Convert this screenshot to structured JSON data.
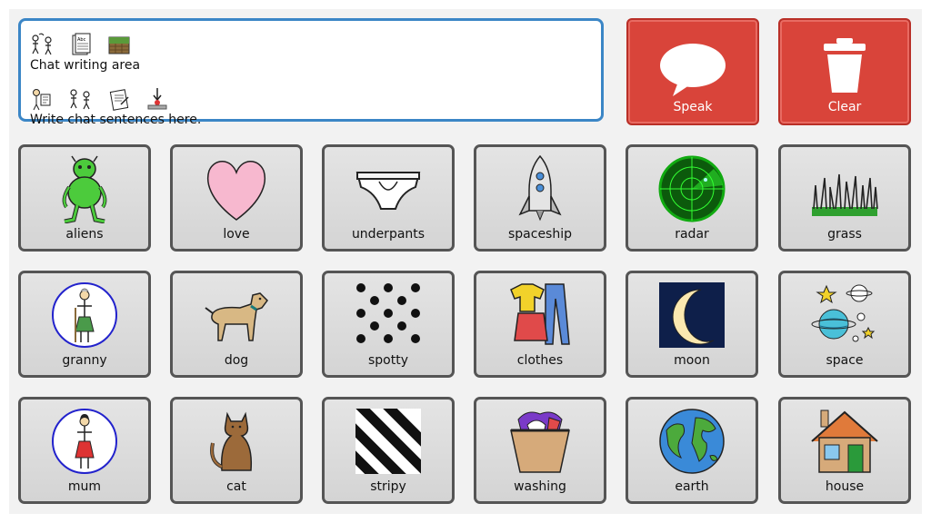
{
  "chat": {
    "line1_text": "Chat writing area",
    "line1_symbols": [
      "chat-symbol-icon",
      "writing-symbol-icon",
      "area-symbol-icon"
    ],
    "line2_text": "Write chat sentences here.",
    "line2_symbols": [
      "write-symbol-icon",
      "chat-symbol-icon",
      "sentences-symbol-icon",
      "here-symbol-icon"
    ]
  },
  "actions": {
    "speak_label": "Speak",
    "clear_label": "Clear"
  },
  "tiles": [
    {
      "label": "aliens",
      "icon": "alien-icon"
    },
    {
      "label": "love",
      "icon": "heart-icon"
    },
    {
      "label": "underpants",
      "icon": "underpants-icon"
    },
    {
      "label": "spaceship",
      "icon": "rocket-icon"
    },
    {
      "label": "radar",
      "icon": "radar-icon"
    },
    {
      "label": "grass",
      "icon": "grass-icon"
    },
    {
      "label": "granny",
      "icon": "granny-icon"
    },
    {
      "label": "dog",
      "icon": "dog-icon"
    },
    {
      "label": "spotty",
      "icon": "spots-icon"
    },
    {
      "label": "clothes",
      "icon": "clothes-icon"
    },
    {
      "label": "moon",
      "icon": "moon-icon"
    },
    {
      "label": "space",
      "icon": "planets-icon"
    },
    {
      "label": "mum",
      "icon": "mum-icon"
    },
    {
      "label": "cat",
      "icon": "cat-icon"
    },
    {
      "label": "stripy",
      "icon": "stripes-icon"
    },
    {
      "label": "washing",
      "icon": "laundry-basket-icon"
    },
    {
      "label": "earth",
      "icon": "globe-icon"
    },
    {
      "label": "house",
      "icon": "house-icon"
    }
  ],
  "colors": {
    "chat_border": "#3b86c6",
    "action_red": "#d9443a",
    "tile_border": "#555555"
  }
}
